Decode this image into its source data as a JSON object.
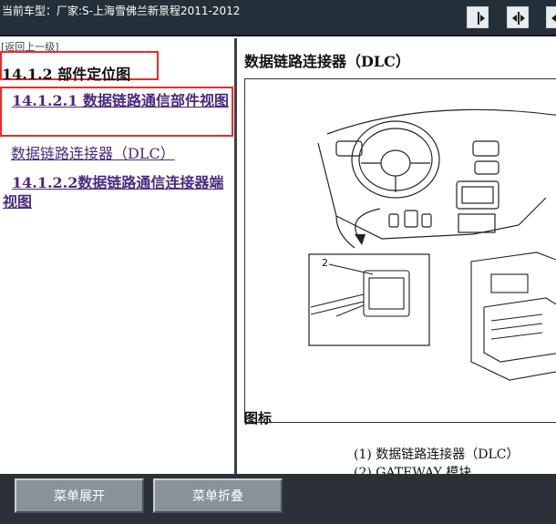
{
  "header": {
    "title": "当前车型：厂家:S-上海雪佛兰新景程2011-2012",
    "buttons": [
      {
        "icon": "move-right-icon"
      },
      {
        "icon": "move-both-icon"
      },
      {
        "icon": "move-left-icon"
      }
    ]
  },
  "sidebar": {
    "back_label": "[返回上一级]",
    "section_title": "14.1.2 部件定位图",
    "items": [
      {
        "label": "14.1.2.1 数据链路通信部件视图"
      },
      {
        "label": "数据链路连接器（DLC）"
      },
      {
        "label": "14.1.2.2数据链路通信连接器端视图"
      }
    ]
  },
  "content": {
    "title": "数据链路连接器（DLC）",
    "figure_callout": "2",
    "legend_heading": "图标",
    "legend": [
      "(1) 数据链路连接器（DLC）",
      "(2) GATEWAY 模块"
    ]
  },
  "footer": {
    "expand_label": "菜单展开",
    "collapse_label": "菜单折叠"
  }
}
